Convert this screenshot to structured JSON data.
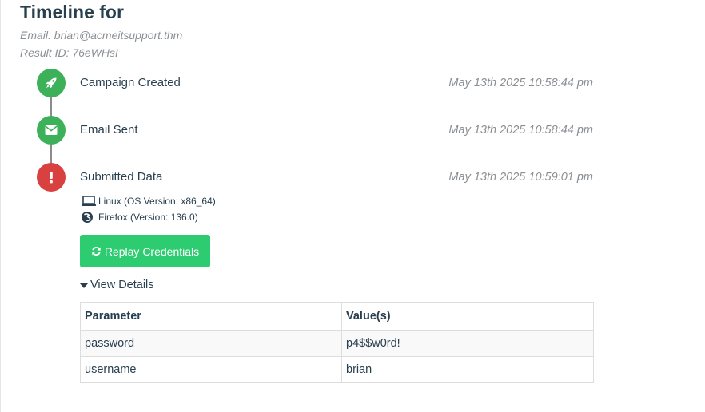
{
  "header": {
    "title": "Timeline for",
    "email": "Email: brian@acmeitsupport.thm",
    "result_id": "Result ID: 76eWHsI"
  },
  "events": [
    {
      "label": "Campaign Created",
      "time": "May 13th 2025 10:58:44 pm",
      "icon": "rocket-icon",
      "color": "#3cb15a"
    },
    {
      "label": "Email Sent",
      "time": "May 13th 2025 10:58:44 pm",
      "icon": "envelope-icon",
      "color": "#3cb15a"
    },
    {
      "label": "Submitted Data",
      "time": "May 13th 2025 10:59:01 pm",
      "icon": "exclamation-icon",
      "color": "#d94040"
    }
  ],
  "submission": {
    "os": "Linux (OS Version: x86_64)",
    "browser": "Firefox (Version: 136.0)",
    "replay_label": "Replay Credentials",
    "view_details_label": "View Details"
  },
  "params_table": {
    "headers": [
      "Parameter",
      "Value(s)"
    ],
    "rows": [
      [
        "password",
        "p4$$w0rd!"
      ],
      [
        "username",
        "brian"
      ]
    ]
  },
  "colors": {
    "button_green": "#2ecc71",
    "success_green": "#3cb15a",
    "danger_red": "#d94040"
  }
}
